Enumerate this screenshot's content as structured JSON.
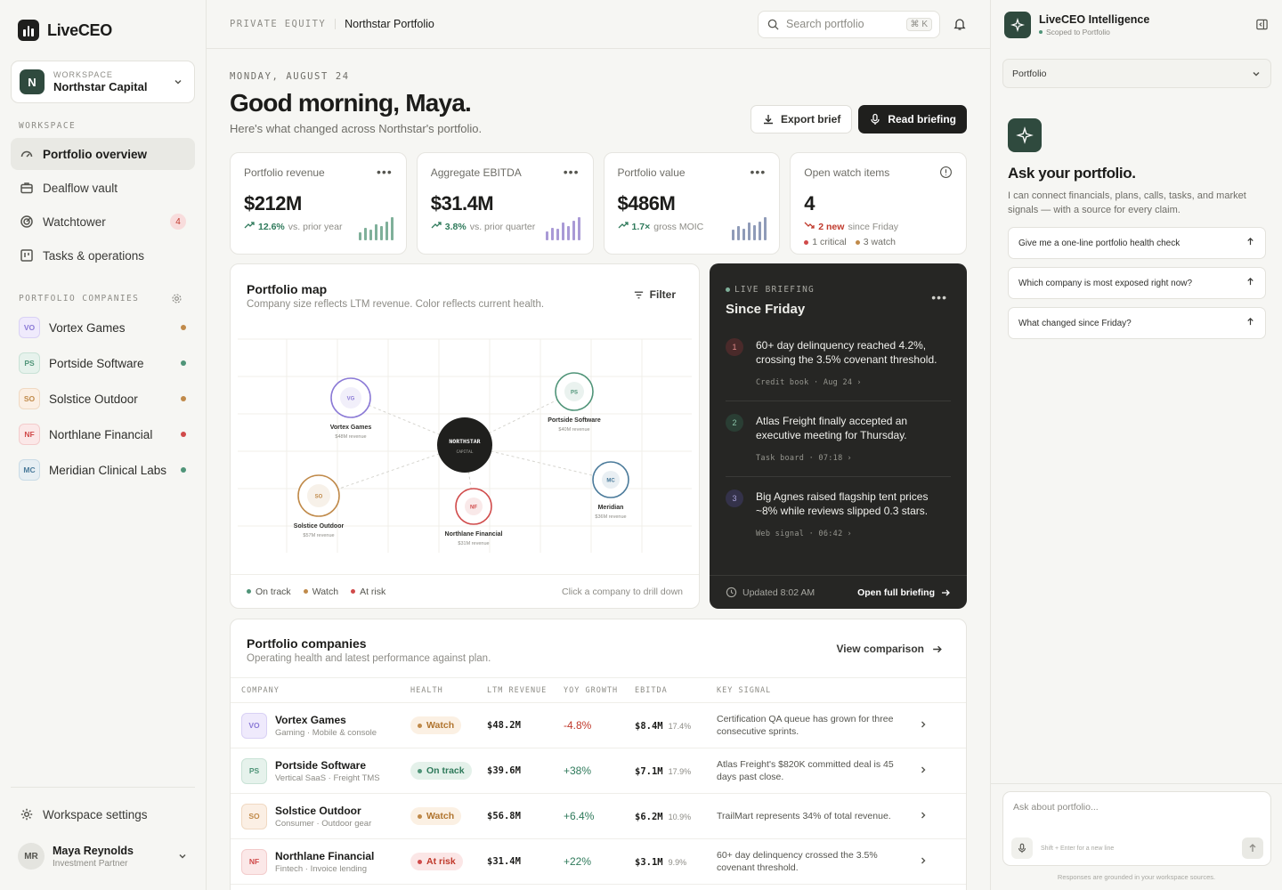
{
  "brand": {
    "name": "LiveCEO"
  },
  "workspace": {
    "label": "WORKSPACE",
    "name": "Northstar Capital",
    "initial": "N"
  },
  "nav": {
    "section_label": "WORKSPACE",
    "items": [
      {
        "label": "Portfolio overview",
        "icon": "gauge-icon"
      },
      {
        "label": "Dealflow vault",
        "icon": "briefcase-icon"
      },
      {
        "label": "Watchtower",
        "icon": "radar-icon",
        "count": "4"
      },
      {
        "label": "Tasks & operations",
        "icon": "kanban-icon"
      }
    ]
  },
  "companies_nav": {
    "section_label": "PORTFOLIO COMPANIES",
    "items": [
      {
        "initials": "VO",
        "name": "Vortex Games",
        "status_color": "#c08a4a"
      },
      {
        "initials": "PS",
        "name": "Portside Software",
        "status_color": "#4f9478"
      },
      {
        "initials": "SO",
        "name": "Solstice Outdoor",
        "status_color": "#c08a4a"
      },
      {
        "initials": "NF",
        "name": "Northlane Financial",
        "status_color": "#d04a4a"
      },
      {
        "initials": "MC",
        "name": "Meridian Clinical Labs",
        "status_color": "#4f9478"
      }
    ]
  },
  "sidebar_footer": {
    "settings_label": "Workspace settings",
    "user_initials": "MR",
    "user_name": "Maya Reynolds",
    "user_role": "Investment Partner"
  },
  "topbar": {
    "crumb_section": "PRIVATE EQUITY",
    "crumb_page": "Northstar Portfolio",
    "search_placeholder": "Search portfolio",
    "search_shortcut": "⌘ K"
  },
  "greeting": {
    "date": "MONDAY, AUGUST 24",
    "title": "Good morning, Maya.",
    "subtitle": "Here's what changed across Northstar's portfolio.",
    "export_label": "Export brief",
    "read_label": "Read briefing"
  },
  "kpis": [
    {
      "label": "Portfolio revenue",
      "value": "$212M",
      "delta": "12.6%",
      "note": "vs. prior year",
      "spark_color": "#7fb09a",
      "spark": [
        0.35,
        0.55,
        0.45,
        0.7,
        0.6,
        0.8,
        1.0
      ]
    },
    {
      "label": "Aggregate EBITDA",
      "value": "$31.4M",
      "delta": "3.8%",
      "note": "vs. prior quarter",
      "spark_color": "#a99ad6",
      "spark": [
        0.4,
        0.55,
        0.5,
        0.75,
        0.6,
        0.85,
        1.0
      ]
    },
    {
      "label": "Portfolio value",
      "value": "$486M",
      "delta": "1.7×",
      "note": "gross MOIC",
      "spark_color": "#8f9bb8",
      "spark": [
        0.45,
        0.6,
        0.5,
        0.75,
        0.65,
        0.8,
        1.0
      ]
    },
    {
      "label": "Open watch items",
      "value": "4",
      "delta": "2 new",
      "note": "since Friday",
      "critical": "1 critical",
      "watch": "3 watch"
    }
  ],
  "map": {
    "title": "Portfolio map",
    "subtitle": "Company size reflects LTM revenue. Color reflects current health.",
    "filter_label": "Filter",
    "center": {
      "line1": "NORTHSTAR",
      "line2": "CAPITAL"
    },
    "nodes": [
      {
        "initials": "VG",
        "name": "Vortex Games",
        "revenue": "$48M revenue",
        "color": "#8b7ad6"
      },
      {
        "initials": "PS",
        "name": "Portside Software",
        "revenue": "$40M revenue",
        "color": "#4f9478"
      },
      {
        "initials": "SO",
        "name": "Solstice Outdoor",
        "revenue": "$57M revenue",
        "color": "#c08a4a"
      },
      {
        "initials": "NF",
        "name": "Northlane Financial",
        "revenue": "$31M revenue",
        "color": "#d04a4a"
      },
      {
        "initials": "MC",
        "name": "Meridian",
        "revenue": "$36M revenue",
        "color": "#4a7a9a"
      }
    ],
    "legend": [
      {
        "label": "On track",
        "color": "#4f9478"
      },
      {
        "label": "Watch",
        "color": "#c08a4a"
      },
      {
        "label": "At risk",
        "color": "#d04a4a"
      }
    ],
    "hint": "Click a company to drill down"
  },
  "briefing": {
    "live_label": "LIVE BRIEFING",
    "title": "Since Friday",
    "items": [
      {
        "num": "1",
        "text": "60+ day delinquency reached 4.2%, crossing the 3.5% covenant threshold.",
        "source": "Credit book · Aug 24",
        "num_bg": "#4a2a2a",
        "num_color": "#e08a8a"
      },
      {
        "num": "2",
        "text": "Atlas Freight finally accepted an executive meeting for Thursday.",
        "source": "Task board · 07:18",
        "num_bg": "#2a3e34",
        "num_color": "#8ac4a8"
      },
      {
        "num": "3",
        "text": "Big Agnes raised flagship tent prices ~8% while reviews slipped 0.3 stars.",
        "source": "Web signal · 06:42",
        "num_bg": "#34324a",
        "num_color": "#a8a2d8"
      }
    ],
    "updated": "Updated 8:02 AM",
    "open_label": "Open full briefing"
  },
  "table": {
    "title": "Portfolio companies",
    "subtitle": "Operating health and latest performance against plan.",
    "view_label": "View comparison",
    "columns": [
      "COMPANY",
      "HEALTH",
      "LTM REVENUE",
      "YOY GROWTH",
      "EBITDA",
      "KEY SIGNAL"
    ],
    "rows": [
      {
        "initials": "VO",
        "name": "Vortex Games",
        "sub": "Gaming · Mobile & console",
        "health": "Watch",
        "revenue": "$48.2M",
        "growth": "-4.8%",
        "ebitda": "$8.4M",
        "margin": "17.4%",
        "signal": "Certification QA queue has grown for three consecutive sprints."
      },
      {
        "initials": "PS",
        "name": "Portside Software",
        "sub": "Vertical SaaS · Freight TMS",
        "health": "On track",
        "revenue": "$39.6M",
        "growth": "+38%",
        "ebitda": "$7.1M",
        "margin": "17.9%",
        "signal": "Atlas Freight's $820K committed deal is 45 days past close."
      },
      {
        "initials": "SO",
        "name": "Solstice Outdoor",
        "sub": "Consumer · Outdoor gear",
        "health": "Watch",
        "revenue": "$56.8M",
        "growth": "+6.4%",
        "ebitda": "$6.2M",
        "margin": "10.9%",
        "signal": "TrailMart represents 34% of total revenue."
      },
      {
        "initials": "NF",
        "name": "Northlane Financial",
        "sub": "Fintech · Invoice lending",
        "health": "At risk",
        "revenue": "$31.4M",
        "growth": "+22%",
        "ebitda": "$3.1M",
        "margin": "9.9%",
        "signal": "60+ day delinquency crossed the 3.5% covenant threshold."
      }
    ]
  },
  "assistant": {
    "title": "LiveCEO Intelligence",
    "scope": "Scoped to Portfolio",
    "scope_select": "Portfolio",
    "heading": "Ask your portfolio.",
    "description": "I can connect financials, plans, calls, tasks, and market signals — with a source for every claim.",
    "suggestions": [
      "Give me a one-line portfolio health check",
      "Which company is most exposed right now?",
      "What changed since Friday?"
    ],
    "input_placeholder": "Ask about portfolio...",
    "input_hint": "Shift + Enter for a new line",
    "disclaimer": "Responses are grounded in your workspace sources."
  }
}
